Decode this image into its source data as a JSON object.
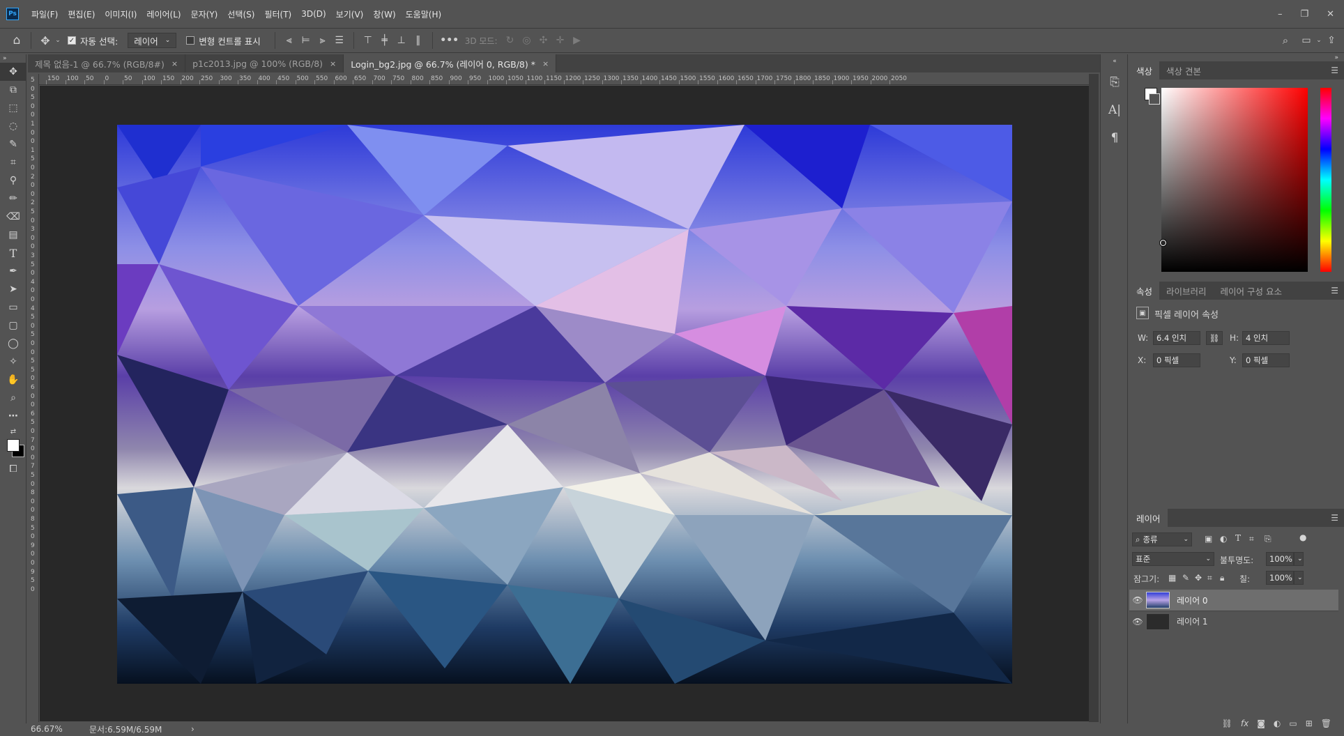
{
  "app": {
    "logo": "Ps"
  },
  "menu": [
    "파일(F)",
    "편집(E)",
    "이미지(I)",
    "레이어(L)",
    "문자(Y)",
    "선택(S)",
    "필터(T)",
    "3D(D)",
    "보기(V)",
    "창(W)",
    "도움말(H)"
  ],
  "window_controls": {
    "minimize": "–",
    "restore": "❐",
    "close": "✕"
  },
  "options": {
    "auto_select_label": "자동 선택:",
    "auto_select_checked": true,
    "auto_select_target": "레이어",
    "show_transform_label": "변형 컨트롤 표시",
    "more": "•••",
    "mode_3d_label": "3D 모드:"
  },
  "tabs": [
    {
      "label": "제목 없음-1 @ 66.7% (RGB/8#)",
      "close": "×",
      "active": false
    },
    {
      "label": "p1c2013.jpg @ 100% (RGB/8)",
      "close": "×",
      "active": false
    },
    {
      "label": "Login_bg2.jpg @ 66.7% (레이어 0, RGB/8) *",
      "close": "×",
      "active": true
    }
  ],
  "ruler": {
    "h": [
      "150",
      "100",
      "50",
      "0",
      "50",
      "100",
      "150",
      "200",
      "250",
      "300",
      "350",
      "400",
      "450",
      "500",
      "550",
      "600",
      "650",
      "700",
      "750",
      "800",
      "850",
      "900",
      "950",
      "1000",
      "1050",
      "1100",
      "1150",
      "1200",
      "1250",
      "1300",
      "1350",
      "1400",
      "1450",
      "1500",
      "1550",
      "1600",
      "1650",
      "1700",
      "1750",
      "1800",
      "1850",
      "1900",
      "1950",
      "2000",
      "2050"
    ],
    "v": [
      "5",
      "0",
      "5",
      "0",
      "0",
      "1",
      "0",
      "0",
      "1",
      "5",
      "0",
      "2",
      "0",
      "0",
      "2",
      "5",
      "0",
      "3",
      "0",
      "0",
      "3",
      "5",
      "0",
      "4",
      "0",
      "0",
      "4",
      "5",
      "0",
      "5",
      "0",
      "0",
      "5",
      "5",
      "0",
      "6",
      "0",
      "0",
      "6",
      "5",
      "0",
      "7",
      "0",
      "0",
      "7",
      "5",
      "0",
      "8",
      "0",
      "0",
      "8",
      "5",
      "0",
      "9",
      "0",
      "0",
      "9",
      "5",
      "0"
    ]
  },
  "status": {
    "zoom": "66.67%",
    "doc": "문서:6.59M/6.59M",
    "arrow": "›"
  },
  "color_panel": {
    "tabs": [
      "색상",
      "색상 견본"
    ],
    "active": 0
  },
  "properties_panel": {
    "tabs": [
      "속성",
      "라이브러리",
      "레이어 구성 요소"
    ],
    "active": 0,
    "title": "픽셀 레이어 속성",
    "w_label": "W:",
    "w_value": "6.4 인치",
    "h_label": "H:",
    "h_value": "4 인치",
    "x_label": "X:",
    "x_value": "0 픽셀",
    "y_label": "Y:",
    "y_value": "0 픽셀"
  },
  "layers_panel": {
    "tab": "레이어",
    "filter": "종류",
    "blend_mode": "표준",
    "opacity_label": "불투명도:",
    "opacity": "100%",
    "lock_label": "잠그기:",
    "fill_label": "칠:",
    "fill": "100%",
    "layers": [
      {
        "name": "레이어 0",
        "selected": true
      },
      {
        "name": "레이어 1",
        "selected": false
      }
    ]
  },
  "colors": {
    "accent": "#31a8ff",
    "panel_bg": "#535353",
    "dark_bg": "#282828",
    "tab_bg": "#424242"
  }
}
